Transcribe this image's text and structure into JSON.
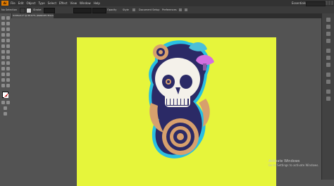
{
  "app": {
    "logo": "Ai"
  },
  "menu": {
    "items": [
      "File",
      "Edit",
      "Object",
      "Type",
      "Select",
      "Effect",
      "View",
      "Window",
      "Help"
    ]
  },
  "workspace": {
    "label": "Essentials"
  },
  "control": {
    "selection_label": "No Selection",
    "stroke_label": "Stroke:",
    "opacity_label": "Opacity",
    "style_label": "Style",
    "document_setup": "Document Setup",
    "preferences": "Preferences",
    "fill_color": "#ffffff",
    "stroke_color": "#d4d4d4"
  },
  "document": {
    "tab_title": "Untitled-1* @ 66.67% (RGB/GPU Preview)"
  },
  "canvas": {
    "artboard_color": "#e6f53b",
    "artwork": "skull with tentacles and mushrooms illustration"
  },
  "overlay": {
    "activate_title": "Activate Windows",
    "activate_sub": "Go to Settings to activate Windows."
  },
  "colors": {
    "skull_white": "#f4f1ea",
    "shadow_blue": "#2b2a66",
    "tentacle": "#d7a06d",
    "mushroom_pink": "#d36fe0",
    "mushroom_cyan": "#4bbfd8",
    "outline_cyan": "#29bfe2"
  }
}
